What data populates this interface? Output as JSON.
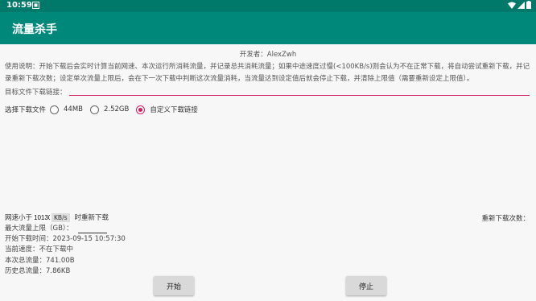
{
  "status": {
    "time": "10:59"
  },
  "app": {
    "title": "流量杀手"
  },
  "developer": "开发者：AlexZwh",
  "instructions": "使用说明：开始下载后会实时计算当前网速、本次运行所消耗流量，并记录总共消耗流量；如果中途速度过慢(<100KB/s)则会认为不在正常下载，将自动尝试重新下载，并记录重新下载次数；设定单次流量上限后，会在下一次下载中判断这次流量消耗，当流量达到设定值后就会停止下载，并清除上限值（需要重新设定上限值）。",
  "url": {
    "label": "目标文件下载链接：",
    "value": "",
    "placeholder": ""
  },
  "choose": {
    "label": "选择下载文件",
    "options": [
      {
        "label": "44MB",
        "checked": false
      },
      {
        "label": "2.52GB",
        "checked": false
      },
      {
        "label": "自定义下载链接",
        "checked": true
      }
    ]
  },
  "speed": {
    "prefix": "网速小于",
    "value": "101300",
    "unit": "KB/s",
    "suffix": "时重新下载"
  },
  "retry_label": "重新下载次数：",
  "info": {
    "max_label": "最大流量上限（GB）：",
    "start_time": "开始下载时间：2023-09-15 10:57:30",
    "current_speed": "当前速度：不在下载中",
    "session_total": "本次总流量：741.00B",
    "history_total": "历史总流量：7.86KB"
  },
  "buttons": {
    "start": "开始",
    "stop": "停止"
  },
  "colors": {
    "primary": "#00897b",
    "primary_dark": "#00796b",
    "accent": "#d81b60"
  }
}
